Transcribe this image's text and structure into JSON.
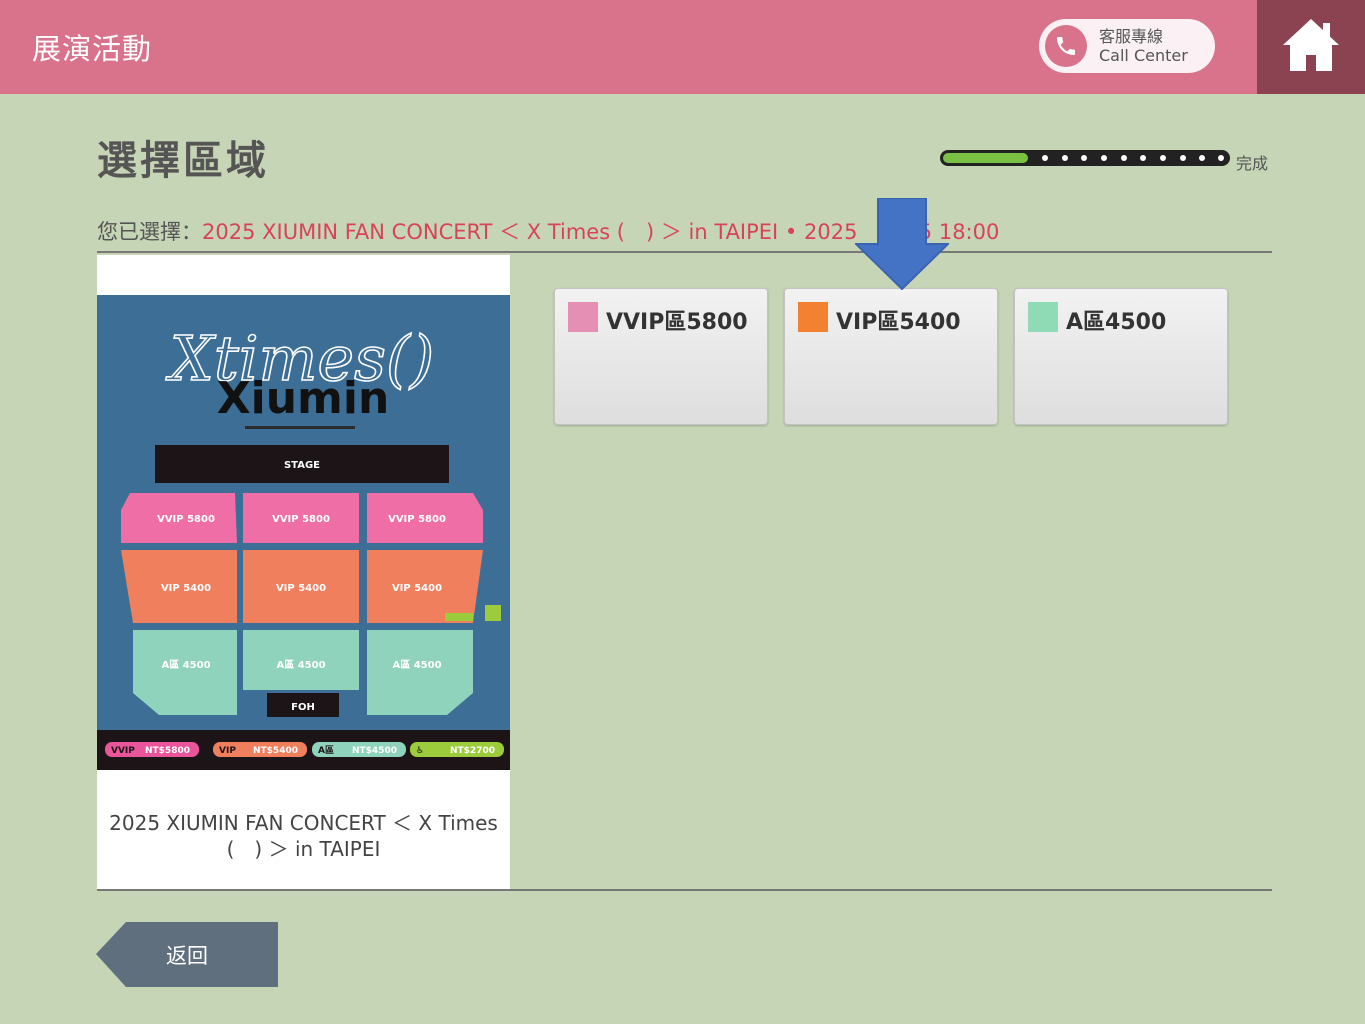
{
  "header": {
    "app_title": "展演活動",
    "call_center_zh": "客服專線",
    "call_center_en": "Call Center",
    "home_icon": "home-icon"
  },
  "page": {
    "title": "選擇區域",
    "progress_label": "完成",
    "progress_fraction": 0.3
  },
  "selection": {
    "prefix": "您已選擇：",
    "value": "2025 XIUMIN FAN CONCERT ＜ X Times (　) ＞ in TAIPEI • 2025",
    "time": "25 18:00"
  },
  "event": {
    "caption_line1": "2025 XIUMIN FAN CONCERT ＜ X Times",
    "caption_line2": "(　) ＞ in TAIPEI",
    "poster": {
      "logo_script": "Xtimes()",
      "logo_name": "Xiumin",
      "stage": "STAGE",
      "foh": "FOH",
      "row_vvip": "VVIP 5800",
      "row_vip": "VIP 5400",
      "row_a": "A區 4500",
      "legend": [
        {
          "tag": "VVIP",
          "price": "NT$5800",
          "color": "#e8559b"
        },
        {
          "tag": "VIP",
          "price": "NT$5400",
          "color": "#f07f5e"
        },
        {
          "tag": "A區",
          "price": "NT$4500",
          "color": "#8fd3bd"
        },
        {
          "tag": "♿",
          "price": "NT$2700",
          "color": "#9ccc3c"
        }
      ]
    }
  },
  "zones": [
    {
      "label": "VVIP區5800",
      "color": "#e58fb5"
    },
    {
      "label": "VIP區5400",
      "color": "#f2822f"
    },
    {
      "label": "A區4500",
      "color": "#8fdbb6"
    }
  ],
  "actions": {
    "back_label": "返回"
  },
  "colors": {
    "header": "#d8738b",
    "home": "#8b4352",
    "background": "#c6d5b5",
    "accent_text": "#d8435a",
    "arrow": "#4472c4"
  }
}
